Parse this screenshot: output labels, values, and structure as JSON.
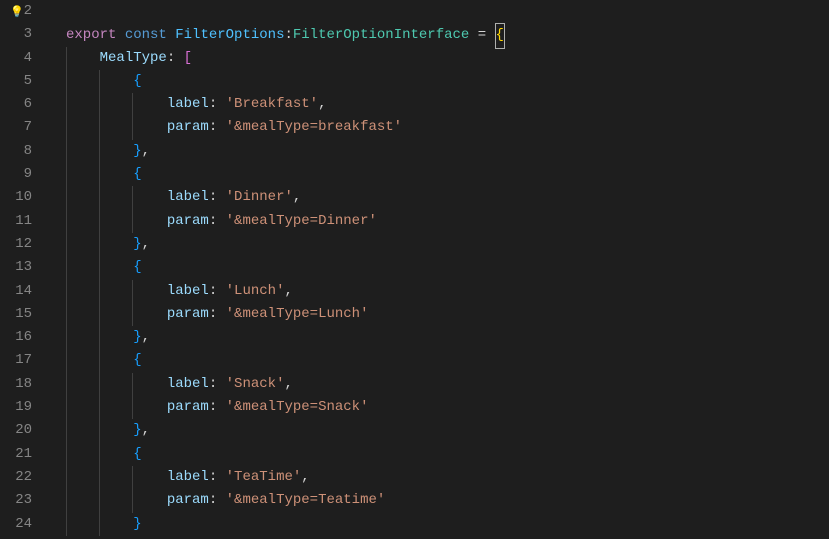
{
  "lines": [
    2,
    3,
    4,
    5,
    6,
    7,
    8,
    9,
    10,
    11,
    12,
    13,
    14,
    15,
    16,
    17,
    18,
    19,
    20,
    21,
    22,
    23,
    24
  ],
  "tokens": {
    "export": "export",
    "const": "const",
    "varName": "FilterOptions",
    "typeName": "FilterOptionInterface",
    "colon": ":",
    "equals": " = ",
    "openBrace": "{",
    "closeBrace": "}",
    "openBracket": "[",
    "closeBracket": "]",
    "comma": ",",
    "mealTypeProp": "MealType",
    "labelProp": "label",
    "paramProp": "param",
    "lightbulb": "💡"
  },
  "items": [
    {
      "label": "'Breakfast'",
      "param": "'&mealType=breakfast'"
    },
    {
      "label": "'Dinner'",
      "param": "'&mealType=Dinner'"
    },
    {
      "label": "'Lunch'",
      "param": "'&mealType=Lunch'"
    },
    {
      "label": "'Snack'",
      "param": "'&mealType=Snack'"
    },
    {
      "label": "'TeaTime'",
      "param": "'&mealType=Teatime'"
    }
  ]
}
